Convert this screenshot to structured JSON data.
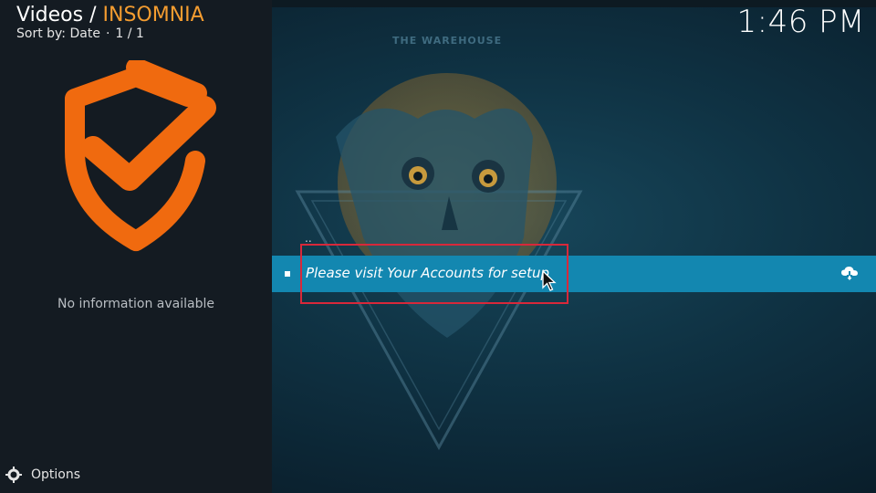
{
  "header": {
    "section": "Videos",
    "separator": " / ",
    "addon_name": "INSOMNIA",
    "sort_label": "Sort by: Date",
    "dot": "·",
    "page_count": "1 / 1"
  },
  "clock": "1:46 PM",
  "info_panel": {
    "no_info_text": "No information available"
  },
  "options_label": "Options",
  "fanart": {
    "watermark_text": "THE WAREHOUSE"
  },
  "list": {
    "parent_label": "..",
    "items": [
      {
        "label": "Please visit Your Accounts for setup",
        "icon": "cloud-download-icon"
      }
    ]
  },
  "colors": {
    "accent": "#f39c30",
    "selection": "#1387b0",
    "highlight_box": "#d8283a",
    "panel_bg": "#141b22"
  }
}
